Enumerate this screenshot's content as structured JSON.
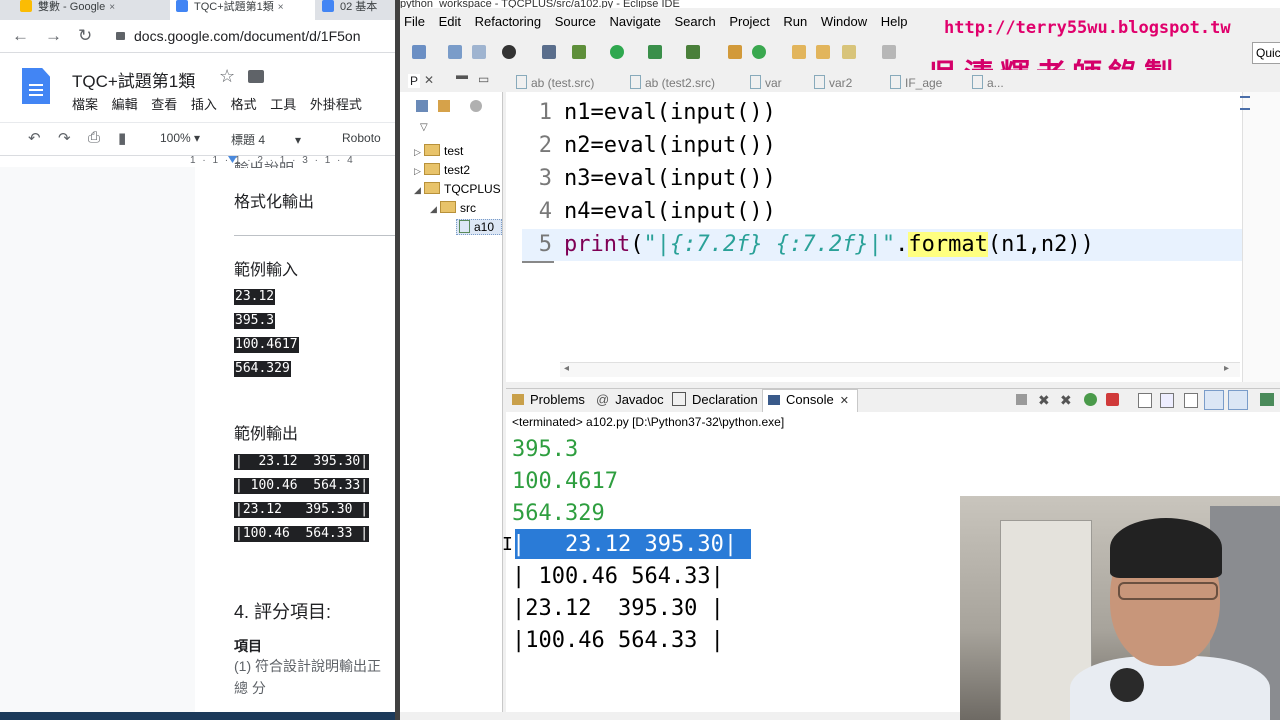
{
  "browser": {
    "tabs": [
      {
        "label": "雙數 - Google",
        "icon_color": "#fbbc04"
      },
      {
        "label": "TQC+試題第1類",
        "icon_color": "#4285f4"
      },
      {
        "label": "02 基本",
        "icon_color": "#4285f4"
      }
    ],
    "tab_close": "×",
    "url": "docs.google.com/document/d/1F5on",
    "nav": {
      "back": "←",
      "forward": "→",
      "reload": "↻"
    }
  },
  "docs": {
    "title": "TQC+試題第1類",
    "menu": [
      "檔案",
      "編輯",
      "查看",
      "插入",
      "格式",
      "工具",
      "外掛程式"
    ],
    "toolbar": {
      "zoom": "100%",
      "style": "標題 4",
      "font": "Roboto"
    },
    "ruler": "1 · 1 · 1 · 2 · 1 · 3 · 1 · 4",
    "content": {
      "partial_top": "輸出說明",
      "format_output": "格式化輸出",
      "sample_input_title": "範例輸入",
      "sample_input": [
        "23.12",
        "395.3",
        "100.4617",
        "564.329"
      ],
      "sample_output_title": "範例輸出",
      "sample_output": [
        "|  23.12  395.30|",
        "| 100.46  564.33|",
        "|23.12   395.30 |",
        "|100.46  564.33 |"
      ],
      "grading_title": "4.  評分項目:",
      "item_label": "項目",
      "item1": "(1) 符合設計說明輸出正",
      "total": "總 分"
    }
  },
  "eclipse": {
    "window_title": "python_workspace - TQCPLUS/src/a102.py - Eclipse IDE",
    "menu": [
      "File",
      "Edit",
      "Refactoring",
      "Source",
      "Navigate",
      "Search",
      "Project",
      "Run",
      "Window",
      "Help"
    ],
    "quick_access": "Quic",
    "watermark_url": "http://terry55wu.blogspot.tw",
    "watermark_name": "吳清輝老師錄製",
    "package_explorer": {
      "tab": "P",
      "items": [
        {
          "label": "test",
          "arrow": "▷"
        },
        {
          "label": "test2",
          "arrow": "▷"
        },
        {
          "label": "TQCPLUS",
          "arrow": "◢"
        },
        {
          "label": "src",
          "arrow": "◢"
        },
        {
          "label": "a10",
          "arrow": ""
        }
      ]
    },
    "editor_tabs": [
      "ab (test.src)",
      "ab (test2.src)",
      "var",
      "var2",
      "IF_age",
      "a..."
    ],
    "code": {
      "lines": [
        {
          "n": "1",
          "text": "n1=eval(input())"
        },
        {
          "n": "2",
          "text": "n2=eval(input())"
        },
        {
          "n": "3",
          "text": "n3=eval(input())"
        },
        {
          "n": "4",
          "text": "n4=eval(input())"
        }
      ],
      "line5": {
        "n": "5",
        "print": "print",
        "open": "(",
        "string": "\"|{:7.2f} {:7.2f}|\"",
        "dot": ".",
        "format": "format",
        "args": "(n1,n2))"
      }
    },
    "console": {
      "tabs": [
        "Problems",
        "Javadoc",
        "Declaration",
        "Console"
      ],
      "tab_icons": {
        "javadoc": "@",
        "console_close": "✕"
      },
      "terminated": "<terminated> a102.py [D:\\Python37-32\\python.exe]",
      "inputs": [
        "395.3",
        "100.4617",
        "564.329"
      ],
      "outputs": [
        "|   23.12 395.30|",
        "| 100.46 564.33|",
        "|23.12  395.30 |",
        "|100.46 564.33 |"
      ],
      "input_color": "#2e9e3f",
      "selection_color": "#2a7bd7"
    }
  }
}
